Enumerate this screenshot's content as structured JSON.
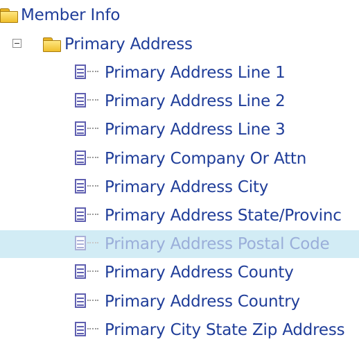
{
  "tree": {
    "root": {
      "label": "Member Info",
      "icon": "folder-icon"
    },
    "group": {
      "label": "Primary Address",
      "icon": "folder-icon",
      "expander": "minus-icon"
    },
    "items": [
      {
        "label": "Primary Address Line 1",
        "selected": false
      },
      {
        "label": "Primary Address Line 2",
        "selected": false
      },
      {
        "label": "Primary Address Line 3",
        "selected": false
      },
      {
        "label": "Primary Company Or Attn",
        "selected": false
      },
      {
        "label": "Primary Address City",
        "selected": false
      },
      {
        "label": "Primary Address State/Provinc",
        "selected": false
      },
      {
        "label": "Primary Address Postal Code",
        "selected": true
      },
      {
        "label": "Primary Address County",
        "selected": false
      },
      {
        "label": "Primary Address Country",
        "selected": false
      },
      {
        "label": "Primary City State Zip Address",
        "selected": false
      }
    ],
    "colors": {
      "text": "#1f3d99",
      "selection": "#d2ecf5",
      "folder": "#f0bf2c",
      "item_icon": "#5f5fb0"
    }
  }
}
